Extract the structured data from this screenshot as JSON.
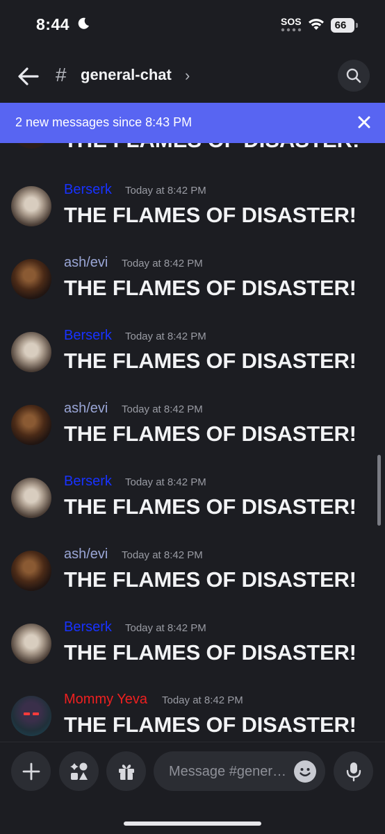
{
  "status_bar": {
    "time": "8:44",
    "sos": "SOS",
    "battery": "66"
  },
  "header": {
    "hash": "#",
    "channel_name": "general-chat",
    "chevron": "›"
  },
  "banner": {
    "text": "2 new messages since 8:43 PM",
    "accent": "#5865f2"
  },
  "messages": {
    "partial_text": "THE FLAMES OF DISASTER!",
    "items": [
      {
        "user": "Berserk",
        "time": "Today at 8:42 PM",
        "text": "THE FLAMES OF DISASTER!",
        "color": "#1832ff"
      },
      {
        "user": "ash/evi",
        "time": "Today at 8:42 PM",
        "text": "THE FLAMES OF DISASTER!",
        "color": "#9aa6d6"
      },
      {
        "user": "Berserk",
        "time": "Today at 8:42 PM",
        "text": "THE FLAMES OF DISASTER!",
        "color": "#1832ff"
      },
      {
        "user": "ash/evi",
        "time": "Today at 8:42 PM",
        "text": "THE FLAMES OF DISASTER!",
        "color": "#9aa6d6"
      },
      {
        "user": "Berserk",
        "time": "Today at 8:42 PM",
        "text": "THE FLAMES OF DISASTER!",
        "color": "#1832ff"
      },
      {
        "user": "ash/evi",
        "time": "Today at 8:42 PM",
        "text": "THE FLAMES OF DISASTER!",
        "color": "#9aa6d6"
      },
      {
        "user": "Berserk",
        "time": "Today at 8:42 PM",
        "text": "THE FLAMES OF DISASTER!",
        "color": "#1832ff"
      },
      {
        "user": "Mommy Yeva",
        "time": "Today at 8:42 PM",
        "text": "THE FLAMES OF DISASTER!",
        "color": "#ee2020"
      }
    ]
  },
  "composer": {
    "placeholder": "Message #gener…",
    "icons": [
      "plus-icon",
      "apps-icon",
      "gift-icon",
      "emoji-icon",
      "microphone-icon"
    ]
  }
}
